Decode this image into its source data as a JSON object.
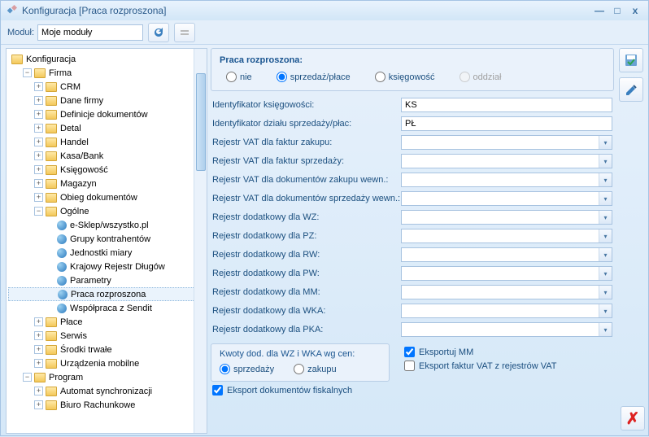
{
  "title": "Konfiguracja [Praca rozproszona]",
  "toolbar": {
    "module_label": "Moduł:",
    "module_value": "Moje moduły"
  },
  "tree": {
    "root": "Konfiguracja",
    "firma": "Firma",
    "crm": "CRM",
    "dane_firmy": "Dane firmy",
    "def_dok": "Definicje dokumentów",
    "detal": "Detal",
    "handel": "Handel",
    "kasa": "Kasa/Bank",
    "ksieg": "Księgowość",
    "magazyn": "Magazyn",
    "obieg": "Obieg dokumentów",
    "ogolne": "Ogólne",
    "esklep": "e-Sklep/wszystko.pl",
    "grupy": "Grupy kontrahentów",
    "jednostki": "Jednostki miary",
    "krd": "Krajowy Rejestr Długów",
    "parametry": "Parametry",
    "praca": "Praca rozproszona",
    "sendit": "Współpraca z Sendit",
    "place": "Płace",
    "serwis": "Serwis",
    "srodki": "Środki trwałe",
    "urz_mob": "Urządzenia mobilne",
    "program": "Program",
    "automat": "Automat synchronizacji",
    "biuro": "Biuro Rachunkowe"
  },
  "panel": {
    "group_title": "Praca rozproszona:",
    "r_nie": "nie",
    "r_sprz": "sprzedaż/płace",
    "r_ksi": "księgowość",
    "r_odd": "oddział",
    "id_ksi": "Identyfikator księgowości:",
    "id_ksi_v": "KS",
    "id_sprz": "Identyfikator działu sprzedaży/płac:",
    "id_sprz_v": "PŁ",
    "r_vat_zak": "Rejestr VAT dla faktur zakupu:",
    "r_vat_spr": "Rejestr VAT dla faktur sprzedaży:",
    "r_vat_dzw": "Rejestr VAT dla dokumentów zakupu wewn.:",
    "r_vat_dsw": "Rejestr VAT dla dokumentów sprzedaży wewn.:",
    "r_dod_wz": "Rejestr dodatkowy dla WZ:",
    "r_dod_pz": "Rejestr dodatkowy dla PZ:",
    "r_dod_rw": "Rejestr dodatkowy dla RW:",
    "r_dod_pw": "Rejestr dodatkowy dla PW:",
    "r_dod_mm": "Rejestr dodatkowy dla MM:",
    "r_dod_wka": "Rejestr dodatkowy dla WKA:",
    "r_dod_pka": "Rejestr dodatkowy dla PKA:",
    "kwoty_title": "Kwoty dod. dla WZ i WKA wg cen:",
    "k_sprz": "sprzedaży",
    "k_zak": "zakupu",
    "eksport_mm": "Eksportuj MM",
    "eksport_vat": "Eksport faktur VAT z rejestrów VAT",
    "eksport_fisk": "Eksport dokumentów fiskalnych"
  }
}
